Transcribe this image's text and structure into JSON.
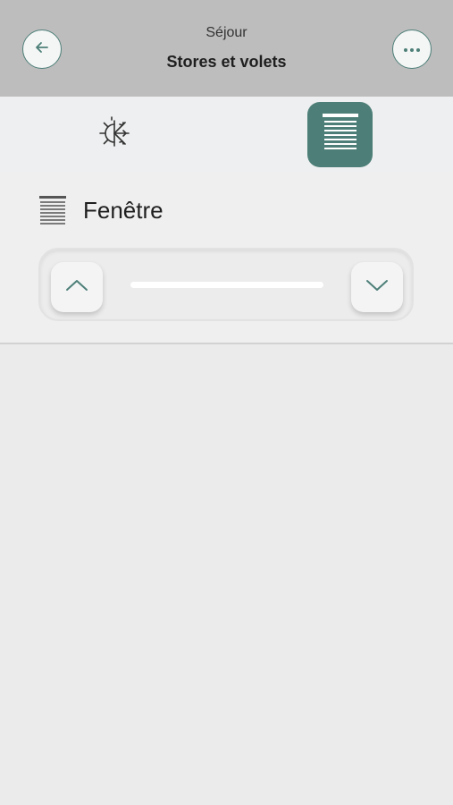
{
  "header": {
    "subtitle": "Séjour",
    "title": "Stores et volets",
    "back_icon": "arrow-left-icon",
    "more_icon": "more-horizontal-icon"
  },
  "tabs": [
    {
      "icon": "sun-snow-icon",
      "selected": false
    },
    {
      "icon": "blinds-icon",
      "selected": true
    }
  ],
  "device": {
    "icon": "blinds-icon",
    "label": "Fenêtre"
  },
  "controls": {
    "up_icon": "chevron-up-icon",
    "down_icon": "chevron-down-icon"
  },
  "colors": {
    "accent": "#4d7f78",
    "header_bg": "#bdbdbd",
    "page_bg": "#ebebeb"
  }
}
